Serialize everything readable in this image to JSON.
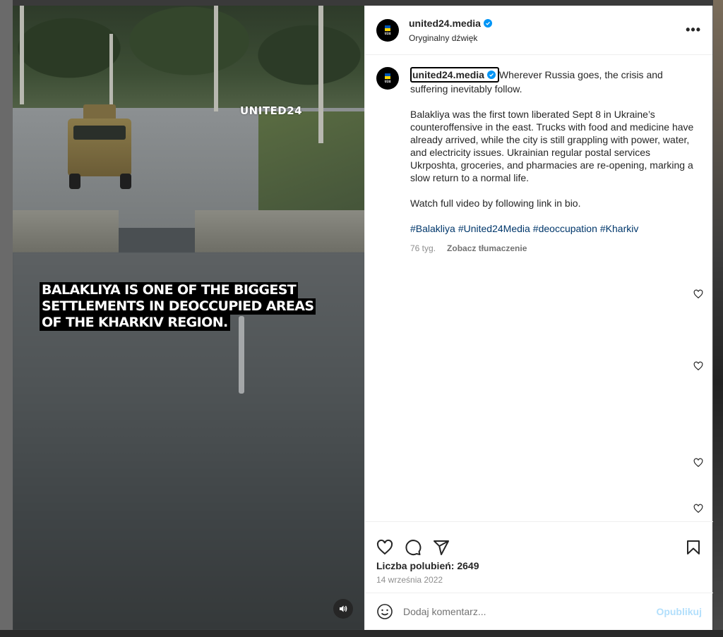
{
  "post": {
    "username": "united24.media",
    "audio": "Oryginalny dźwięk",
    "more_label": "•••",
    "media": {
      "watermark": "UNITED24",
      "caption_lines": [
        "BALAKLIYA IS ONE OF THE BIGGEST",
        "SETTLEMENTS IN DEOCCUPIED AREAS",
        "OF THE KHARKIV REGION."
      ],
      "mute_icon": "speaker-icon"
    },
    "caption": {
      "username": "united24.media",
      "first_text": "Wherever Russia goes, the crisis and suffering inevitably follow.",
      "paragraph_2": "Balakliya was the first town liberated Sept 8 in Ukraine’s counteroffensive in the east. Trucks with food and medicine have already arrived, while the city is still grappling with power, water, and electricity issues. Ukrainian regular postal services Ukrposhta, groceries, and pharmacies are re-opening, marking a slow return to a normal life.",
      "paragraph_3": "Watch full video by following link in bio.",
      "hashtags": [
        "#Balakliya",
        "#United24Media",
        "#deoccupation",
        "#Kharkiv"
      ],
      "age": "76 tyg.",
      "translate": "Zobacz tłumaczenie"
    },
    "likes": "Liczba polubień: 2649",
    "date": "14 września 2022",
    "comment_placeholder": "Dodaj komentarz...",
    "publish": "Opublikuj"
  },
  "colors": {
    "verified": "#0095f6",
    "hashtag": "#00376b",
    "publish_disabled": "#b2dffc",
    "flag_blue": "#0057b7",
    "flag_yellow": "#ffd700"
  }
}
